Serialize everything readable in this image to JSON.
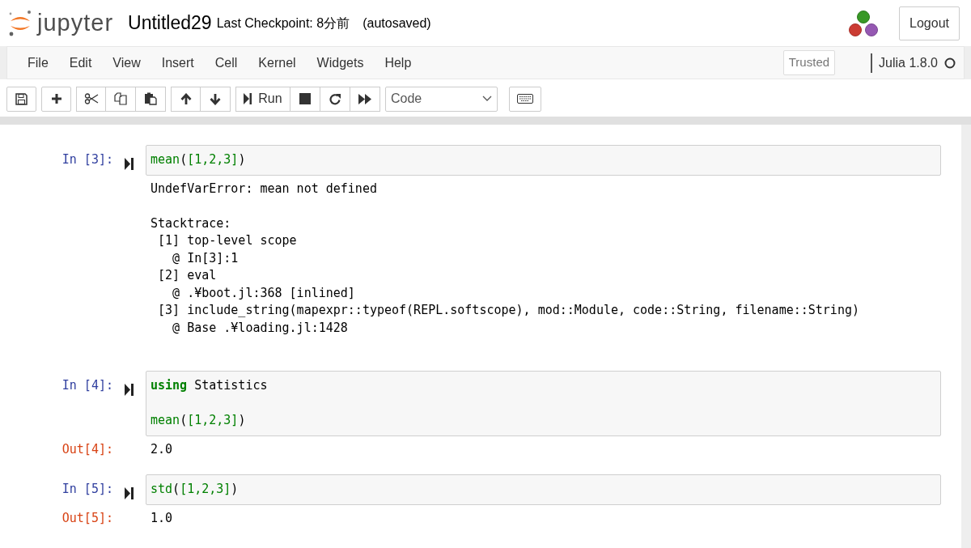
{
  "header": {
    "logo_text": "jupyter",
    "notebook_name": "Untitled29",
    "checkpoint": "Last Checkpoint: 8分前",
    "autosave": "(autosaved)",
    "logout": "Logout"
  },
  "menu": [
    "File",
    "Edit",
    "View",
    "Insert",
    "Cell",
    "Kernel",
    "Widgets",
    "Help"
  ],
  "trusted": "Trusted",
  "kernel": {
    "name": "Julia 1.8.0",
    "busy": false
  },
  "toolbar": {
    "run": "Run",
    "cell_type": "Code"
  },
  "cells": [
    {
      "prompt": "In [3]:",
      "code": [
        {
          "blank_line_before": false,
          "tokens": [
            {
              "text": "mean",
              "kind": "builtin"
            },
            {
              "text": "(",
              "kind": "plain"
            },
            {
              "text": "[1,2,3]",
              "kind": "number"
            },
            {
              "text": ")",
              "kind": "plain"
            }
          ]
        }
      ],
      "output": [
        "UndefVarError: mean not defined",
        "Stacktrace:\n [1] top-level scope\n   @ In[3]:1\n [2] eval\n   @ .¥boot.jl:368 [inlined]\n [3] include_string(mapexpr::typeof(REPL.softscope), mod::Module, code::String, filename::String)\n   @ Base .¥loading.jl:1428"
      ]
    },
    {
      "prompt": "In [4]:",
      "code": [
        {
          "blank_line_before": false,
          "tokens": [
            {
              "text": "using",
              "kind": "keyword"
            },
            {
              "text": " Statistics",
              "kind": "plain"
            }
          ]
        },
        {
          "blank_line_before": true,
          "tokens": [
            {
              "text": "mean",
              "kind": "builtin"
            },
            {
              "text": "(",
              "kind": "plain"
            },
            {
              "text": "[1,2,3]",
              "kind": "number"
            },
            {
              "text": ")",
              "kind": "plain"
            }
          ]
        }
      ],
      "output_prompt": "Out[4]:",
      "output": [
        "2.0"
      ]
    },
    {
      "prompt": "In [5]:",
      "code": [
        {
          "blank_line_before": false,
          "tokens": [
            {
              "text": "std",
              "kind": "builtin"
            },
            {
              "text": "(",
              "kind": "plain"
            },
            {
              "text": "[1,2,3]",
              "kind": "number"
            },
            {
              "text": ")",
              "kind": "plain"
            }
          ]
        }
      ],
      "output_prompt": "Out[5]:",
      "output": [
        "1.0"
      ]
    }
  ]
}
